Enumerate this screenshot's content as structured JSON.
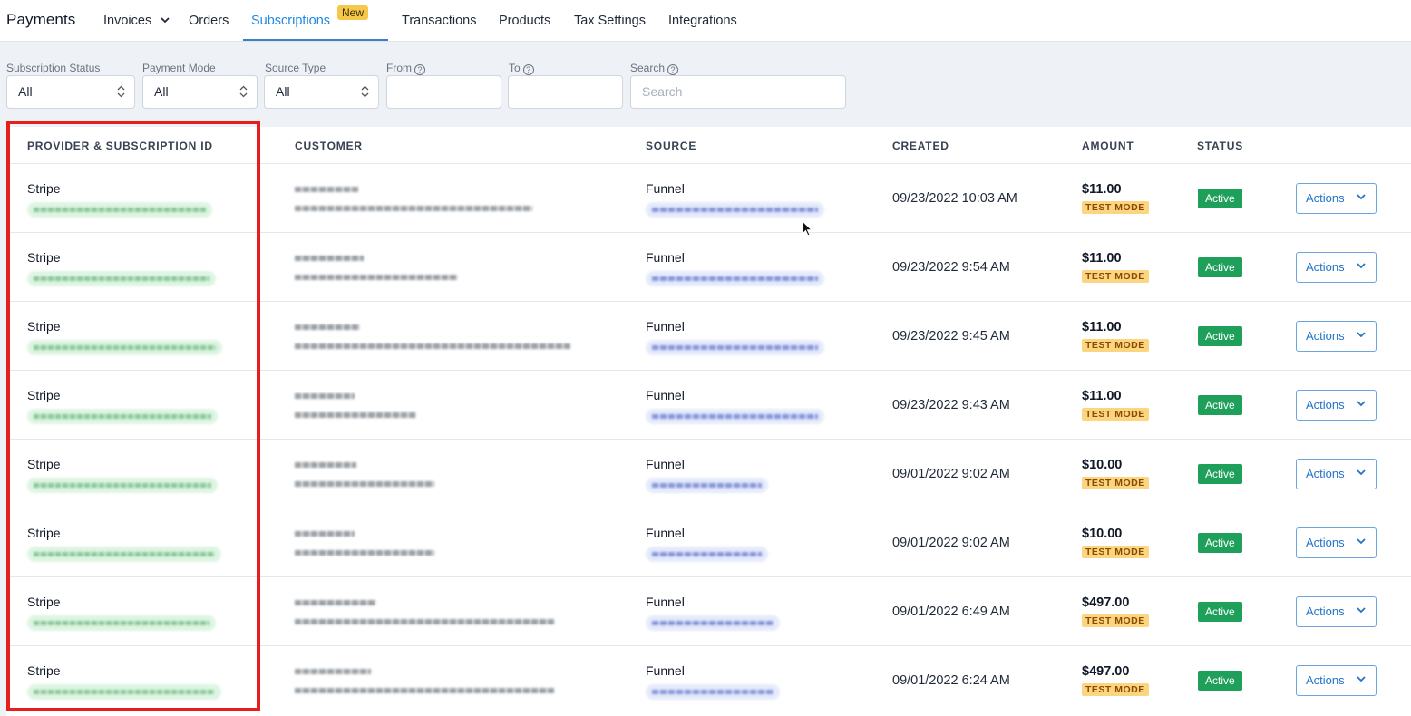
{
  "nav": {
    "brand": "Payments",
    "items": [
      {
        "label": "Invoices",
        "has_dropdown": true
      },
      {
        "label": "Orders"
      },
      {
        "label": "Subscriptions",
        "active": true,
        "badge": "New"
      },
      {
        "label": "Transactions"
      },
      {
        "label": "Products"
      },
      {
        "label": "Tax Settings"
      },
      {
        "label": "Integrations"
      }
    ]
  },
  "filters": {
    "subscription_status": {
      "label": "Subscription Status",
      "value": "All"
    },
    "payment_mode": {
      "label": "Payment Mode",
      "value": "All"
    },
    "source_type": {
      "label": "Source Type",
      "value": "All"
    },
    "from": {
      "label": "From",
      "value": ""
    },
    "to": {
      "label": "To",
      "value": ""
    },
    "search": {
      "label": "Search",
      "placeholder": "Search",
      "value": ""
    }
  },
  "table": {
    "columns": [
      "PROVIDER & SUBSCRIPTION ID",
      "CUSTOMER",
      "SOURCE",
      "CREATED",
      "AMOUNT",
      "STATUS"
    ],
    "rows": [
      {
        "provider": "Stripe",
        "source": "Funnel",
        "created": "09/23/2022 10:03 AM",
        "amount": "$11.00",
        "mode": "TEST MODE",
        "status": "Active",
        "action": "Actions"
      },
      {
        "provider": "Stripe",
        "source": "Funnel",
        "created": "09/23/2022 9:54 AM",
        "amount": "$11.00",
        "mode": "TEST MODE",
        "status": "Active",
        "action": "Actions"
      },
      {
        "provider": "Stripe",
        "source": "Funnel",
        "created": "09/23/2022 9:45 AM",
        "amount": "$11.00",
        "mode": "TEST MODE",
        "status": "Active",
        "action": "Actions"
      },
      {
        "provider": "Stripe",
        "source": "Funnel",
        "created": "09/23/2022 9:43 AM",
        "amount": "$11.00",
        "mode": "TEST MODE",
        "status": "Active",
        "action": "Actions"
      },
      {
        "provider": "Stripe",
        "source": "Funnel",
        "created": "09/01/2022 9:02 AM",
        "amount": "$10.00",
        "mode": "TEST MODE",
        "status": "Active",
        "action": "Actions"
      },
      {
        "provider": "Stripe",
        "source": "Funnel",
        "created": "09/01/2022 9:02 AM",
        "amount": "$10.00",
        "mode": "TEST MODE",
        "status": "Active",
        "action": "Actions"
      },
      {
        "provider": "Stripe",
        "source": "Funnel",
        "created": "09/01/2022 6:49 AM",
        "amount": "$497.00",
        "mode": "TEST MODE",
        "status": "Active",
        "action": "Actions"
      },
      {
        "provider": "Stripe",
        "source": "Funnel",
        "created": "09/01/2022 6:24 AM",
        "amount": "$497.00",
        "mode": "TEST MODE",
        "status": "Active",
        "action": "Actions"
      }
    ]
  },
  "colors": {
    "accent": "#1e88e5",
    "status_active": "#1ea05b",
    "test_mode": "#fcd581",
    "highlight": "#e61e1e"
  }
}
